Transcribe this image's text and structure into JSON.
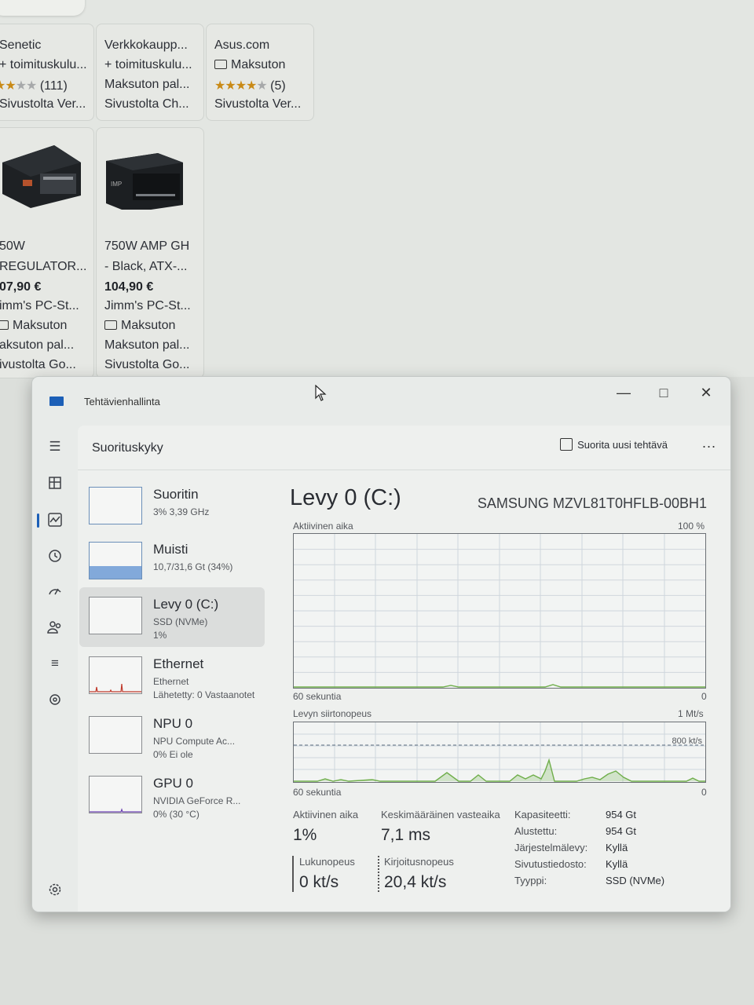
{
  "shop": {
    "top_row": [
      {
        "seller": "Senetic",
        "shipping": "+ toimituskulu...",
        "rating_stars": 3,
        "reviews": "(111)",
        "source": "Sivustolta Ver..."
      },
      {
        "seller": "Verkkokaupp...",
        "shipping": "+ toimituskulu...",
        "note": "Maksuton pal...",
        "source": "Sivustolta Ch..."
      },
      {
        "seller": "Asus.com",
        "shipping": "Maksuton",
        "rating_stars": 4,
        "reviews": "(5)",
        "source": "Sivustolta Ver..."
      }
    ],
    "products": [
      {
        "name_l1": "50W",
        "name_l2": "REGULATOR...",
        "price": "07,90 €",
        "seller": "imm's PC-St...",
        "shipping": "Maksuton",
        "note": "aksuton pal...",
        "source": "ivustolta Go..."
      },
      {
        "name_l1": "750W AMP GH",
        "name_l2": "- Black, ATX-...",
        "price": "104,90 €",
        "seller": "Jimm's PC-St...",
        "shipping": "Maksuton",
        "note": "Maksuton pal...",
        "source": "Sivustolta Go..."
      }
    ]
  },
  "window": {
    "title": "Tehtävienhallinta",
    "page_title": "Suorituskyky",
    "run_new_task": "Suorita uusi tehtävä",
    "more": "...",
    "minimize": "—",
    "maximize": "□",
    "close": "✕"
  },
  "nav": {
    "icons": [
      "menu-icon",
      "processes-icon",
      "performance-icon",
      "history-icon",
      "startup-icon",
      "users-icon",
      "details-icon",
      "services-icon",
      "settings-icon"
    ],
    "active": "performance-icon"
  },
  "devices": [
    {
      "name": "Suoritin",
      "sub1": "3% 3,39 GHz",
      "sub2": ""
    },
    {
      "name": "Muisti",
      "sub1": "10,7/31,6 Gt (34%)",
      "sub2": ""
    },
    {
      "name": "Levy 0 (C:)",
      "sub1": "SSD (NVMe)",
      "sub2": "1%"
    },
    {
      "name": "Ethernet",
      "sub1": "Ethernet",
      "sub2": "Lähetetty: 0 Vastaanotet"
    },
    {
      "name": "NPU 0",
      "sub1": "NPU Compute Ac...",
      "sub2": "0% Ei ole"
    },
    {
      "name": "GPU 0",
      "sub1": "NVIDIA GeForce R...",
      "sub2": "0% (30 °C)"
    }
  ],
  "detail": {
    "title": "Levy 0 (C:)",
    "model": "SAMSUNG MZVL81T0HFLB-00BH1",
    "graph1_label": "Aktiivinen aika",
    "graph1_max": "100 %",
    "graph1_xlabel": "60 sekuntia",
    "graph1_zero": "0",
    "graph2_label": "Levyn siirtonopeus",
    "graph2_max": "1 Mt/s",
    "graph2_mid": "800 kt/s",
    "graph2_xlabel": "60 sekuntia",
    "graph2_zero": "0",
    "stats": {
      "active_time_label": "Aktiivinen aika",
      "active_time": "1%",
      "response_label": "Keskimääräinen vasteaika",
      "response": "7,1 ms",
      "read_label": "Lukunopeus",
      "read": "0 kt/s",
      "write_label": "Kirjoitusnopeus",
      "write": "20,4 kt/s"
    },
    "props": [
      {
        "k": "Kapasiteetti:",
        "v": "954 Gt"
      },
      {
        "k": "Alustettu:",
        "v": "954 Gt"
      },
      {
        "k": "Järjestelmälevy:",
        "v": "Kyllä"
      },
      {
        "k": "Sivutustiedosto:",
        "v": "Kyllä"
      },
      {
        "k": "Tyyppi:",
        "v": "SSD (NVMe)"
      }
    ]
  },
  "colors": {
    "accent": "#1c5fb7",
    "graph_line": "#6fae4a",
    "memory_fill": "#5b8fd0"
  }
}
